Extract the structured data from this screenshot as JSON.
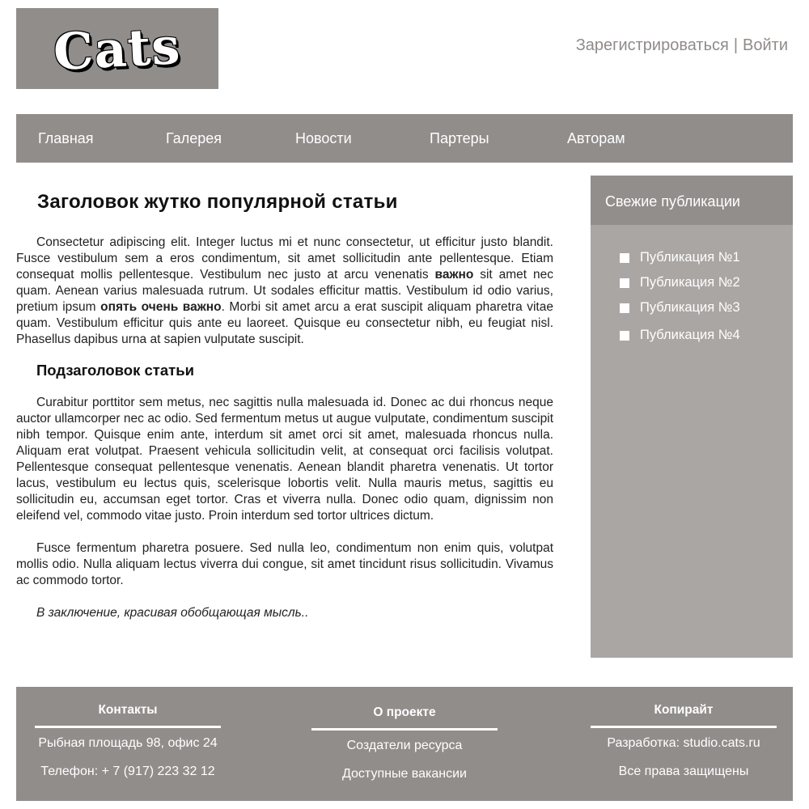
{
  "header": {
    "logo_text": "Cats",
    "register": "Зарегистрироваться",
    "separator": "|",
    "login": "Войти"
  },
  "nav": [
    "Главная",
    "Галерея",
    "Новости",
    "Партеры",
    "Авторам"
  ],
  "article": {
    "title": "Заголовок жутко популярной статьи",
    "p1": {
      "a": "Consectetur adipiscing elit. Integer luctus mi et nunc consectetur, ut efficitur justo blandit. Fusce vestibulum sem a eros condimentum, sit amet sollicitudin ante pellentesque. Etiam consequat mollis pellentesque. Vestibulum nec justo at arcu venenatis ",
      "bold1": "важно",
      "b": " sit amet nec quam. Aenean varius malesuada rutrum. Ut sodales efficitur mattis. Vestibulum id odio varius, pretium ipsum ",
      "bold2": "опять очень важно",
      "c": ". Morbi sit amet arcu a erat suscipit aliquam pharetra vitae quam. Vestibulum efficitur quis ante eu laoreet. Quisque eu consectetur nibh, eu feugiat nisl. Phasellus dapibus urna at sapien vulputate suscipit."
    },
    "subtitle": "Подзаголовок статьи",
    "p2": "Curabitur porttitor sem metus, nec sagittis nulla malesuada id. Donec ac dui rhoncus neque auctor ullamcorper nec ac odio. Sed fermentum metus ut augue vulputate, condimentum suscipit nibh tempor. Quisque enim ante, interdum sit amet orci sit amet, malesuada rhoncus nulla. Aliquam erat volutpat. Praesent vehicula sollicitudin velit, at consequat orci facilisis volutpat. Pellentesque consequat pellentesque venenatis. Aenean blandit pharetra venenatis. Ut tortor lacus, vestibulum eu lectus quis, scelerisque lobortis velit. Nulla mauris metus, sagittis eu sollicitudin eu, accumsan eget tortor. Cras et viverra nulla. Donec odio quam, dignissim non eleifend vel, commodo vitae justo. Proin interdum sed tortor ultrices dictum.",
    "p3": "Fusce fermentum pharetra posuere. Sed nulla leo, condimentum non enim quis, volutpat mollis odio. Nulla aliquam lectus viverra dui congue, sit amet tincidunt risus sollicitudin. Vivamus ac commodo tortor.",
    "conclusion": "В заключение, красивая обобщающая мысль.."
  },
  "sidebar": {
    "title": "Свежие публикации",
    "items": [
      "Публикация №1",
      "Публикация №2",
      "Публикация №3",
      "Публикация №4"
    ]
  },
  "footer": {
    "contacts": {
      "title": "Контакты",
      "address": "Рыбная площадь 98, офис 24",
      "phone": "Телефон: + 7 (917) 223 32 12"
    },
    "about": {
      "title": "О проекте",
      "creators": "Создатели ресурса",
      "vacancies": "Доступные вакансии"
    },
    "copyright": {
      "title": "Копирайт",
      "dev": "Разработка: studio.cats.ru",
      "rights": "Все права защищены"
    }
  }
}
